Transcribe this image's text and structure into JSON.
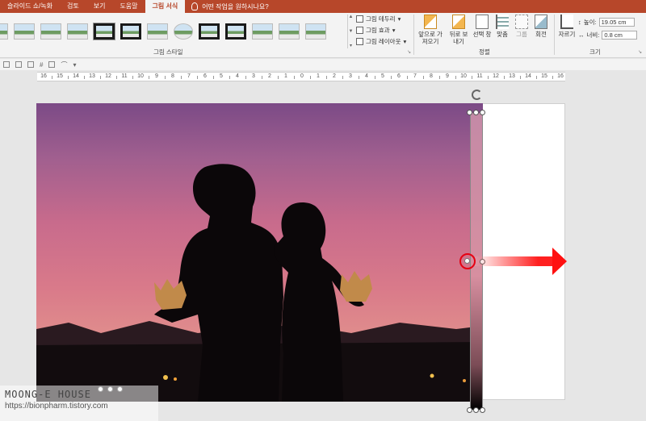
{
  "tabs": [
    {
      "label": "슬라이드 쇼/녹화",
      "active": false
    },
    {
      "label": "검토",
      "active": false
    },
    {
      "label": "보기",
      "active": false
    },
    {
      "label": "도움말",
      "active": false
    },
    {
      "label": "그림 서식",
      "active": true
    }
  ],
  "tell_me": "어떤 작업을 원하시나요?",
  "ribbon": {
    "picture_styles_group": "그림 스타일",
    "picture_border": "그림 테두리",
    "picture_effects": "그림 효과",
    "picture_layout": "그림 레이아웃",
    "arrange_group": "정렬",
    "bring_forward": "앞으로 가져오기",
    "send_backward": "뒤로 보내기",
    "selection_pane": "선택 창",
    "align": "맞춤",
    "group": "그룹",
    "rotate": "회전",
    "size_group": "크기",
    "crop": "자르기",
    "height_label": "높이:",
    "height_value": "19.05 cm",
    "width_label": "너비:",
    "width_value": "0.8 cm"
  },
  "ruler_numbers": [
    "16",
    "15",
    "14",
    "13",
    "12",
    "11",
    "10",
    "9",
    "8",
    "7",
    "6",
    "5",
    "4",
    "3",
    "2",
    "1",
    "0",
    "1",
    "2",
    "3",
    "4",
    "5",
    "6",
    "7",
    "8",
    "9",
    "10",
    "11",
    "12",
    "13",
    "14",
    "15",
    "16"
  ],
  "watermark": {
    "title": "MOONG-E HOUSE",
    "url": "https://bionpharm.tistory.com"
  },
  "colors": {
    "accent": "#b7472a",
    "arrow": "#ff1010",
    "highlight_ring": "#e60012"
  }
}
